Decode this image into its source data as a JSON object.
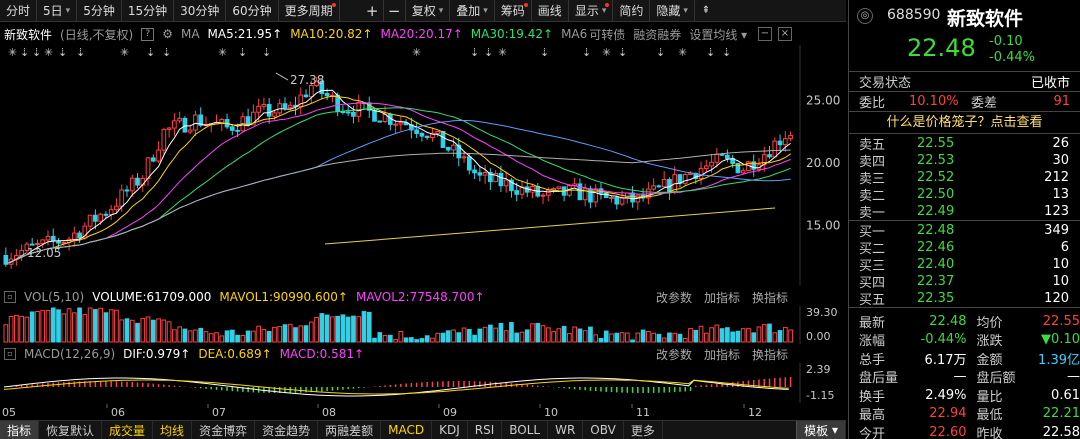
{
  "toolbar": {
    "items": [
      "分时",
      "5日",
      "5分钟",
      "15分钟",
      "30分钟",
      "60分钟",
      "更多周期",
      "+",
      "−",
      "复权",
      "叠加",
      "筹码",
      "画线",
      "显示",
      "简约",
      "隐藏"
    ]
  },
  "title": {
    "stock": "新致软件",
    "mode": "(日线,不复权)",
    "ma_label": "MA",
    "ma5": "MA5:21.95",
    "ma10": "MA10:20.82",
    "ma20": "MA20:20.17",
    "ma30": "MA30:19.42",
    "ma6": "MA6",
    "ma6_extra": "可转债",
    "margin": "融资融券",
    "settings": "设置均线"
  },
  "price_axis": {
    "ticks": [
      "25.00",
      "20.00",
      "15.00"
    ]
  },
  "annotations": {
    "high": "27.38",
    "low": "12.05"
  },
  "volume": {
    "label": "VOL(5,10)",
    "volume": "VOLUME:61709.000",
    "mavol1": "MAVOL1:90990.600",
    "mavol2": "MAVOL2:77548.700",
    "ticks": [
      "39.30",
      "0.00"
    ],
    "btn_params": "改参数",
    "btn_add": "加指标",
    "btn_change": "换指标"
  },
  "macd": {
    "label": "MACD(12,26,9)",
    "dif": "DIF:0.979",
    "dea": "DEA:0.689",
    "macd": "MACD:0.581",
    "ticks": [
      "2.39",
      "-1.15"
    ],
    "btn_params": "改参数",
    "btn_add": "加指标",
    "btn_change": "换指标"
  },
  "months": [
    "05",
    "06",
    "07",
    "08",
    "09",
    "10",
    "11",
    "12"
  ],
  "tabs": [
    "指标",
    "恢复默认",
    "成交量",
    "均线",
    "资金博弈",
    "资金趋势",
    "两融差额",
    "MACD",
    "KDJ",
    "RSI",
    "BOLL",
    "WR",
    "OBV",
    "更多",
    "模板"
  ],
  "panel": {
    "code": "688590",
    "name": "新致软件",
    "price": "22.48",
    "change": "-0.10",
    "change_pct": "-0.44%",
    "status_label": "交易状态",
    "status_value": "已收市",
    "weibi_label": "委比",
    "weibi_value": "10.10%",
    "weicha_label": "委差",
    "weicha_value": "91",
    "link": "什么是价格笼子？点击查看",
    "asks": [
      {
        "label": "卖五",
        "price": "22.55",
        "vol": "26"
      },
      {
        "label": "卖四",
        "price": "22.53",
        "vol": "30"
      },
      {
        "label": "卖三",
        "price": "22.52",
        "vol": "212"
      },
      {
        "label": "卖二",
        "price": "22.50",
        "vol": "13"
      },
      {
        "label": "卖一",
        "price": "22.49",
        "vol": "123"
      }
    ],
    "bids": [
      {
        "label": "买一",
        "price": "22.48",
        "vol": "349"
      },
      {
        "label": "买二",
        "price": "22.46",
        "vol": "6"
      },
      {
        "label": "买三",
        "price": "22.40",
        "vol": "10"
      },
      {
        "label": "买四",
        "price": "22.37",
        "vol": "10"
      },
      {
        "label": "买五",
        "price": "22.35",
        "vol": "120"
      }
    ],
    "stats": [
      {
        "l1": "最新",
        "v1": "22.48",
        "l2": "均价",
        "v2": "22.55"
      },
      {
        "l1": "涨幅",
        "v1": "-0.44%",
        "l2": "涨跌",
        "v2": "▼0.10"
      },
      {
        "l1": "总手",
        "v1": "6.17万",
        "l2": "金额",
        "v2": "1.39亿"
      },
      {
        "l1": "盘后量",
        "v1": "—",
        "l2": "盘后额",
        "v2": "—"
      },
      {
        "l1": "换手",
        "v1": "2.49%",
        "l2": "量比",
        "v2": "0.61"
      },
      {
        "l1": "最高",
        "v1": "22.94",
        "l2": "最低",
        "v2": "22.21"
      },
      {
        "l1": "今开",
        "v1": "22.60",
        "l2": "昨收",
        "v2": "22.58"
      }
    ]
  },
  "colors": {
    "up": "#ff4040",
    "down": "#3ddc3d",
    "candle_down_fill": "#2fd0e8",
    "ma5": "#ffffff",
    "ma10": "#ffd400",
    "ma20": "#ff40ff",
    "ma30": "#30e070"
  }
}
